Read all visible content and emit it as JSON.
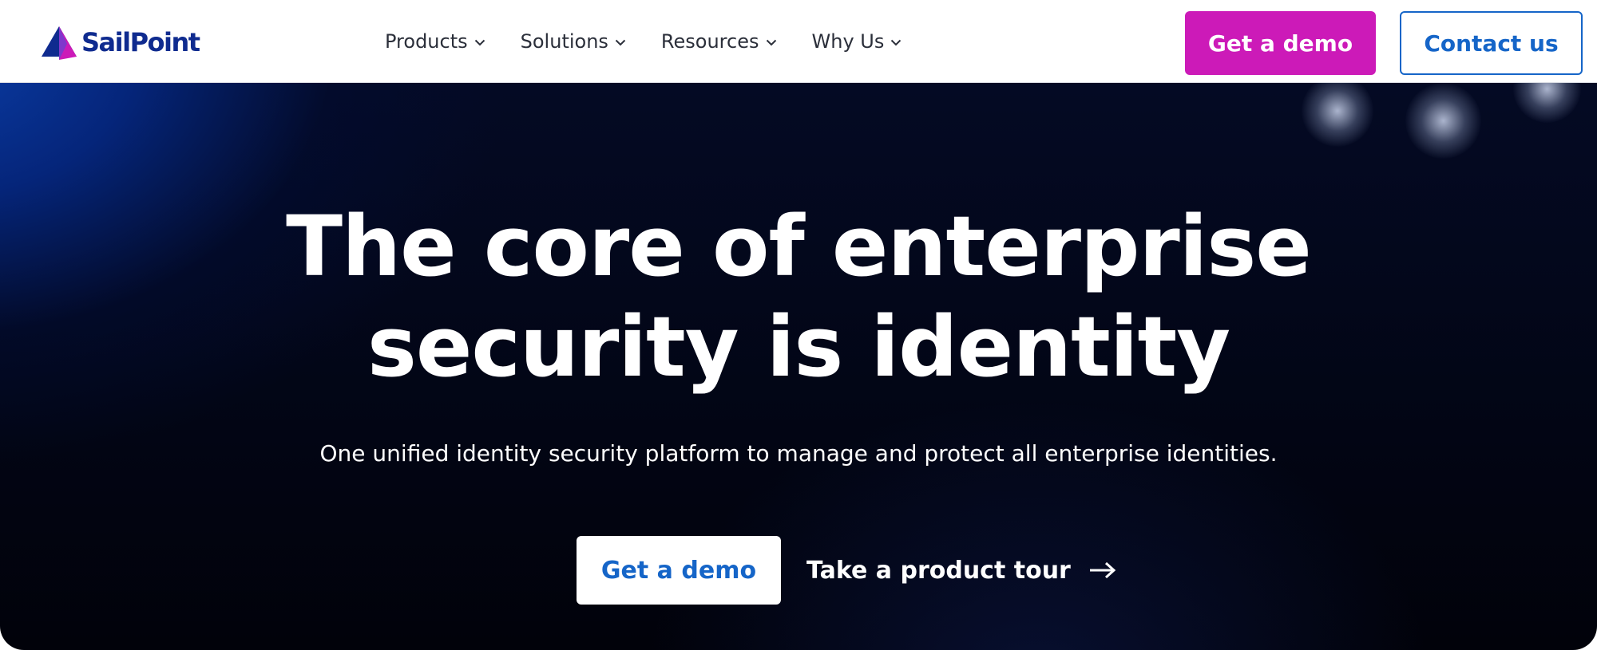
{
  "brand": {
    "name": "SailPoint",
    "logo_icon": "sail-triangle-icon",
    "colors": {
      "primary": "#0f2b8f",
      "accent": "#cc1ab8",
      "link": "#1565c8"
    }
  },
  "nav": {
    "items": [
      {
        "label": "Products",
        "icon": "chevron-down-icon"
      },
      {
        "label": "Solutions",
        "icon": "chevron-down-icon"
      },
      {
        "label": "Resources",
        "icon": "chevron-down-icon"
      },
      {
        "label": "Why Us",
        "icon": "chevron-down-icon"
      }
    ],
    "demo_label": "Get a demo",
    "contact_label": "Contact us"
  },
  "hero": {
    "title_line1": "The core of enterprise",
    "title_line2": "security is identity",
    "subtitle": "One unified identity security platform to manage and protect all enterprise identities.",
    "demo_label": "Get a demo",
    "tour_label": "Take a product tour",
    "tour_icon": "arrow-right-icon"
  }
}
